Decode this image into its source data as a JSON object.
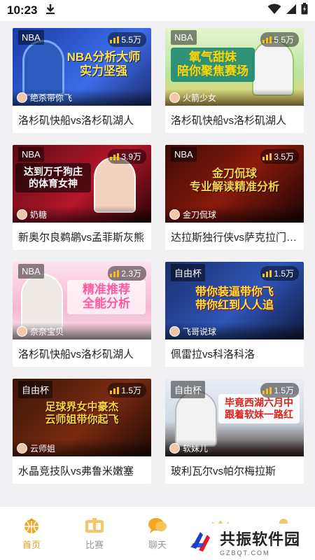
{
  "status": {
    "time": "10:23"
  },
  "cards": [
    {
      "tag": "NBA",
      "heat": "5.5万",
      "banner": "NBA分析大师\n实力坚强",
      "anchor": "绝杀带你飞",
      "title": "洛杉矶快船vs洛杉矶湖人"
    },
    {
      "tag": "NBA",
      "heat": "5.5万",
      "banner": "氧气甜妹\n陪你聚焦赛场",
      "anchor": "火箭少女",
      "title": "洛杉矶快船vs洛杉矶湖人"
    },
    {
      "tag": "NBA",
      "heat": "3.9万",
      "banner": "达到万千狗庄\n的体育女神",
      "anchor": "奶糖",
      "title": "新奥尔良鹈鹕vs孟菲斯灰熊"
    },
    {
      "tag": "NBA",
      "heat": "3.5万",
      "banner": "金刀侃球\n专业解读精准分析",
      "anchor": "金刀侃球",
      "title": "达拉斯独行侠vs萨克拉门托国王"
    },
    {
      "tag": "NBA",
      "heat": "2.3万",
      "banner": "精准推荐\n全能分析",
      "anchor": "奈奈宝贝",
      "title": "洛杉矶快船vs洛杉矶湖人"
    },
    {
      "tag": "自由杯",
      "heat": "1.5万",
      "banner": "带你装逼带你飞\n带你红到人人追",
      "anchor": "飞哥说球",
      "title": "佩雷拉vs科洛科洛"
    },
    {
      "tag": "自由杯",
      "heat": "1.5万",
      "banner": "足球界女中豪杰\n云师姐带你起飞",
      "anchor": "云师姐",
      "title": "水晶竞技队vs弗鲁米嫩塞"
    },
    {
      "tag": "自由杯",
      "heat": "1.5万",
      "banner": "毕竟西湖六月中\n跟着软妹一路红",
      "anchor": "软妹儿",
      "title": "玻利瓦尔vs帕尔梅拉斯"
    }
  ],
  "tabs": [
    {
      "label": "首页",
      "icon": "home-basketball-icon"
    },
    {
      "label": "比赛",
      "icon": "match-board-icon"
    },
    {
      "label": "聊天",
      "icon": "chat-bubble-icon"
    },
    {
      "label": "",
      "icon": "crown-icon"
    },
    {
      "label": "",
      "icon": "profile-icon"
    }
  ],
  "watermark": {
    "title": "共振软件园",
    "sub": "GZBQT.COM"
  },
  "colors": {
    "accent": "#f0a020",
    "title_text": "#222222",
    "background": "#f1f1f3"
  }
}
